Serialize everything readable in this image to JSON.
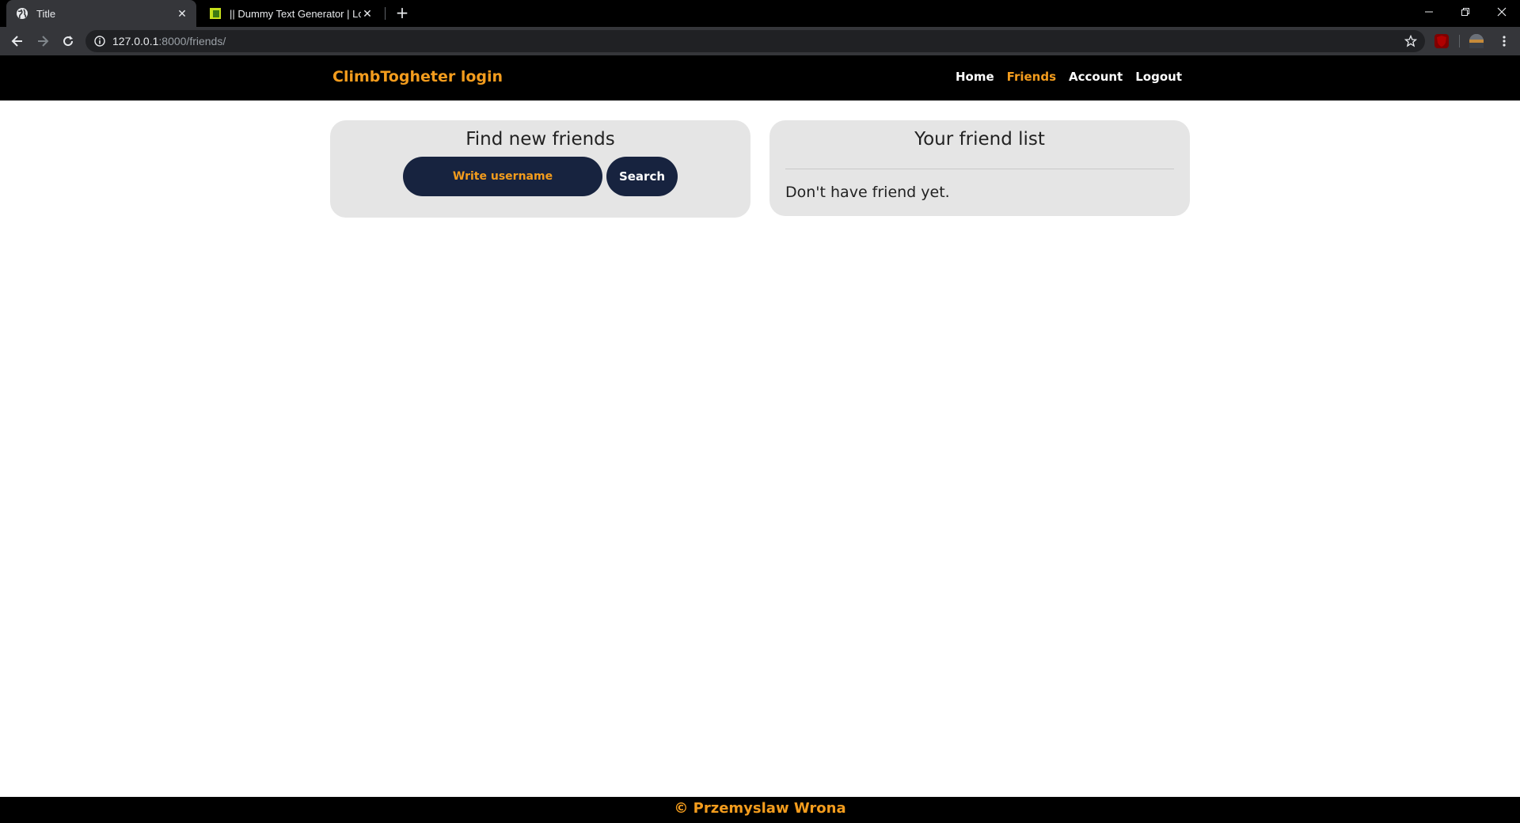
{
  "browser": {
    "tabs": [
      {
        "title": "Title",
        "active": true
      },
      {
        "title": "|| Dummy Text Generator | Lorem",
        "active": false
      }
    ],
    "url_host": "127.0.0.1",
    "url_rest": ":8000/friends/"
  },
  "site": {
    "brand": "ClimbTogheter login",
    "nav": [
      {
        "label": "Home",
        "active": false
      },
      {
        "label": "Friends",
        "active": true
      },
      {
        "label": "Account",
        "active": false
      },
      {
        "label": "Logout",
        "active": false
      }
    ]
  },
  "find_friends": {
    "title": "Find new friends",
    "input_placeholder": "Write username",
    "search_label": "Search"
  },
  "friend_list": {
    "title": "Your friend list",
    "empty_message": "Don't have friend yet."
  },
  "footer": {
    "text": "© Przemyslaw Wrona"
  },
  "colors": {
    "accent": "#f39c1d",
    "header_bg": "#000000",
    "card_bg": "#e5e5e5",
    "button_bg": "#17233f"
  }
}
